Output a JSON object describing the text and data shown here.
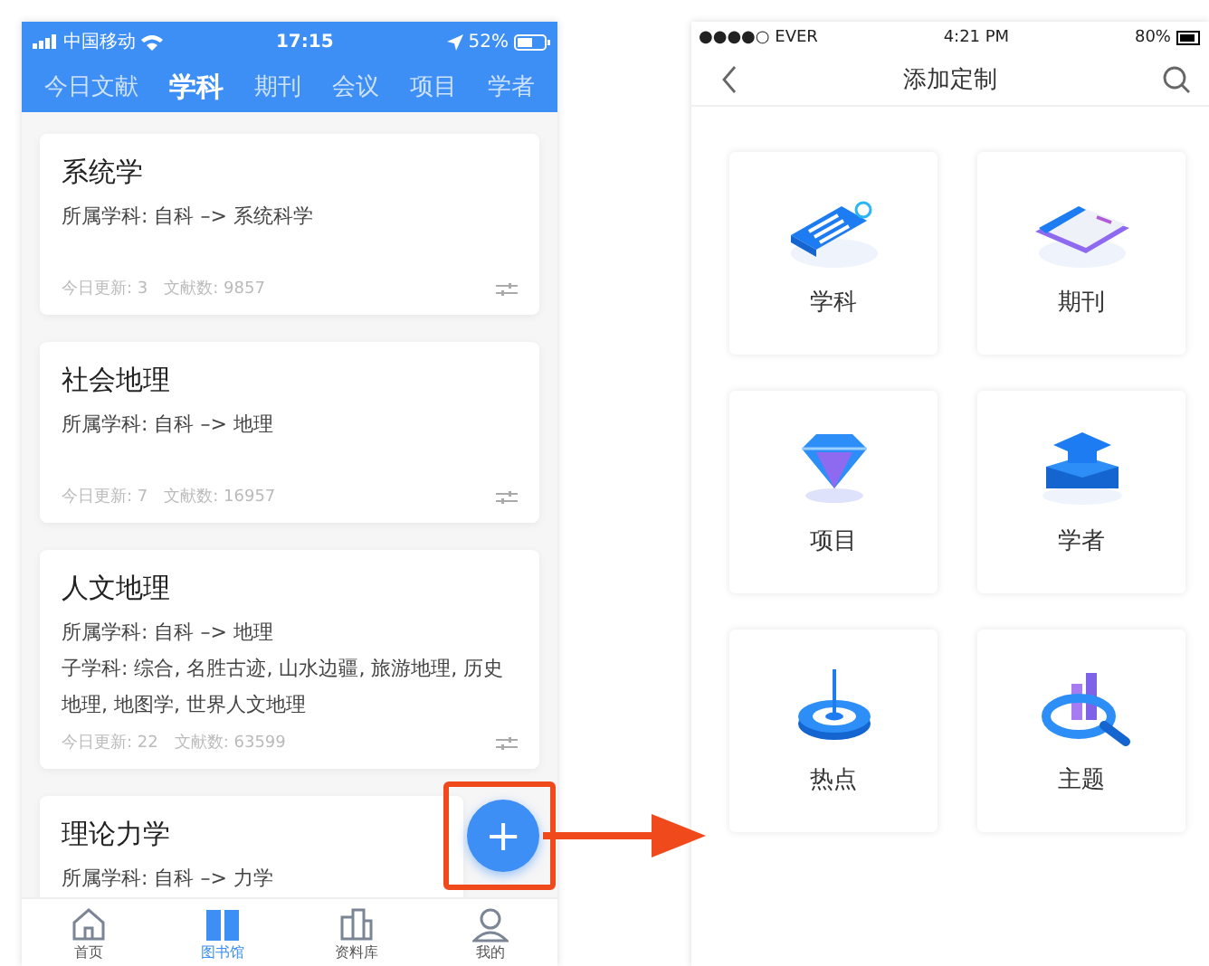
{
  "left_phone": {
    "status_bar": {
      "carrier": "中国移动",
      "time": "17:15",
      "battery": "52%"
    },
    "tabs": [
      {
        "label": "今日文献",
        "selected": false
      },
      {
        "label": "学科",
        "selected": true
      },
      {
        "label": "期刊",
        "selected": false
      },
      {
        "label": "会议",
        "selected": false
      },
      {
        "label": "项目",
        "selected": false
      },
      {
        "label": "学者",
        "selected": false
      }
    ],
    "cards": [
      {
        "title": "系统学",
        "subject": "所属学科: 自科 –> 系统科学",
        "updates": "今日更新: 3",
        "count": "文献数: 9857"
      },
      {
        "title": "社会地理",
        "subject": "所属学科: 自科 –> 地理",
        "updates": "今日更新: 7",
        "count": "文献数: 16957"
      },
      {
        "title": "人文地理",
        "subject": "所属学科: 自科 –> 地理",
        "subfields": "子学科: 综合, 名胜古迹, 山水边疆, 旅游地理, 历史地理, 地图学, 世界人文地理",
        "updates": "今日更新: 22",
        "count": "文献数: 63599"
      },
      {
        "title": "理论力学",
        "subject": "所属学科: 自科 –> 力学"
      }
    ],
    "add_button": {
      "label": "+",
      "highlighted": true
    },
    "bottom_nav": [
      {
        "label": "首页",
        "selected": false
      },
      {
        "label": "图书馆",
        "selected": true
      },
      {
        "label": "资料库",
        "selected": false
      },
      {
        "label": "我的",
        "selected": false
      }
    ]
  },
  "right_phone": {
    "status_bar": {
      "carrier": "●●●●○ EVER",
      "time": "4:21 PM",
      "battery": "80%"
    },
    "title": "添加定制",
    "options": [
      {
        "label": "学科"
      },
      {
        "label": "期刊"
      },
      {
        "label": "项目"
      },
      {
        "label": "学者"
      },
      {
        "label": "热点"
      },
      {
        "label": "主题"
      }
    ]
  }
}
